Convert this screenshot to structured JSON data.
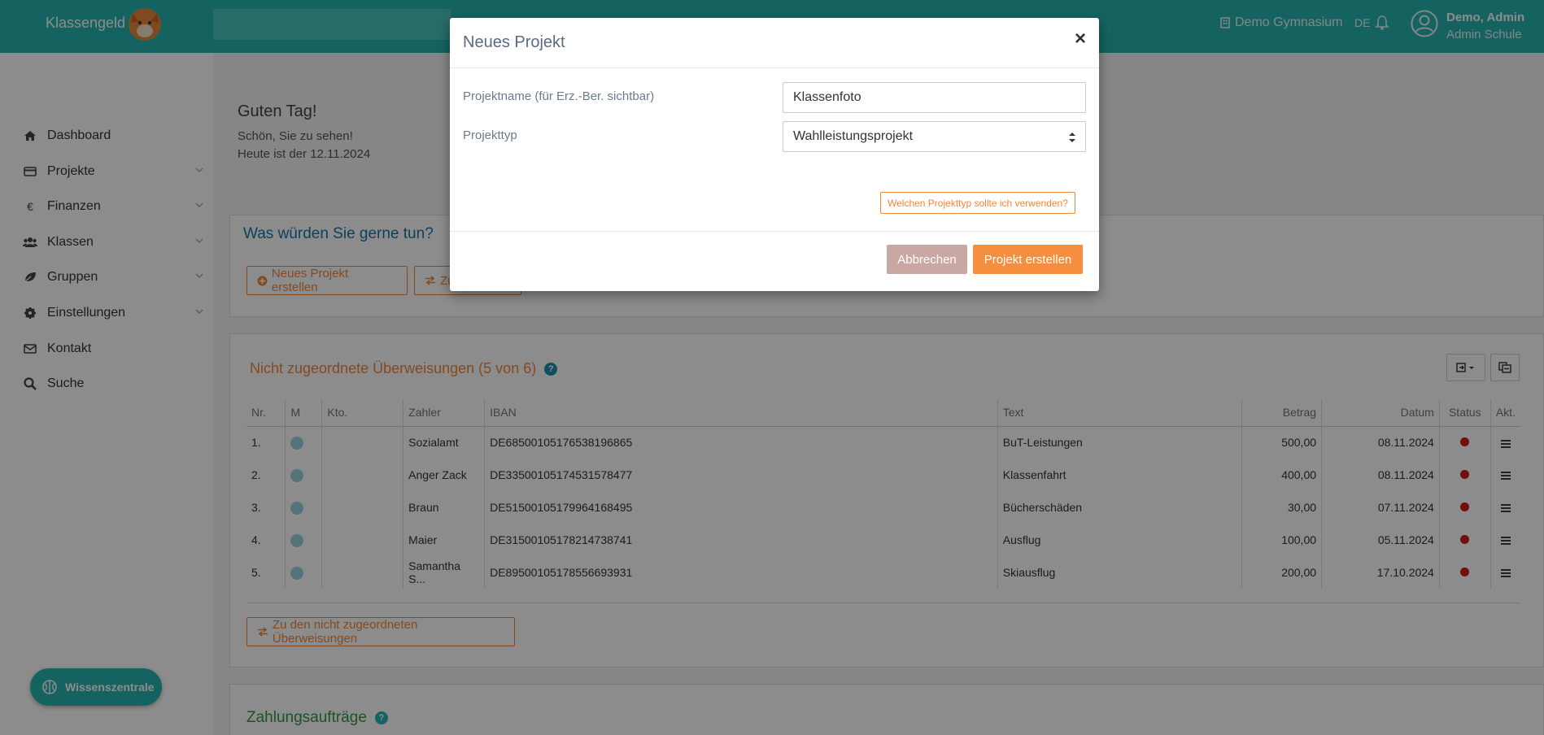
{
  "header": {
    "brand": "Klassengeld",
    "school": "Demo Gymnasium",
    "language": "DE",
    "user_name": "Demo, Admin",
    "user_role": "Admin Schule",
    "accent_color": "#27b5b0"
  },
  "sidebar": {
    "items": [
      {
        "label": "Dashboard",
        "icon": "home-icon"
      },
      {
        "label": "Projekte",
        "icon": "credit-card-icon"
      },
      {
        "label": "Finanzen",
        "icon": "euro-icon"
      },
      {
        "label": "Klassen",
        "icon": "users-icon"
      },
      {
        "label": "Gruppen",
        "icon": "leaf-icon"
      },
      {
        "label": "Einstellungen",
        "icon": "gear-icon"
      },
      {
        "label": "Kontakt",
        "icon": "envelope-icon"
      },
      {
        "label": "Suche",
        "icon": "search-icon"
      }
    ],
    "wissenszentrale": "Wissenszentrale"
  },
  "greeting": {
    "title": "Guten Tag!",
    "line1": "Schön, Sie zu sehen!",
    "line2": "Heute ist der 12.11.2024"
  },
  "actions_panel": {
    "title": "Was würden Sie gerne tun?",
    "new_project": "Neues Projekt erstellen",
    "second_button_partial": "Zu"
  },
  "transfers": {
    "title": "Nicht zugeordnete Überweisungen (5 von 6)",
    "columns": [
      "Nr.",
      "M",
      "Kto.",
      "Zahler",
      "IBAN",
      "Text",
      "Betrag",
      "Datum",
      "Status",
      "Akt."
    ],
    "rows": [
      {
        "nr": "1.",
        "zahler": "Sozialamt",
        "iban": "DE68500105176538196865",
        "text": "BuT-Leistungen",
        "betrag": "500,00",
        "datum": "08.11.2024"
      },
      {
        "nr": "2.",
        "zahler": "Anger Zack",
        "iban": "DE33500105174531578477",
        "text": "Klassenfahrt",
        "betrag": "400,00",
        "datum": "08.11.2024"
      },
      {
        "nr": "3.",
        "zahler": "Braun",
        "iban": "DE51500105179964168495",
        "text": "Bücherschäden",
        "betrag": "30,00",
        "datum": "07.11.2024"
      },
      {
        "nr": "4.",
        "zahler": "Maier",
        "iban": "DE31500105178214738741",
        "text": "Ausflug",
        "betrag": "100,00",
        "datum": "05.11.2024"
      },
      {
        "nr": "5.",
        "zahler": "Samantha S...",
        "iban": "DE89500105178556693931",
        "text": "Skiausflug",
        "betrag": "200,00",
        "datum": "17.10.2024"
      }
    ],
    "link_button": "Zu den nicht zugeordneten Überweisungen"
  },
  "zahlungsauftraege": {
    "title": "Zahlungsaufträge"
  },
  "modal": {
    "title": "Neues Projekt",
    "close": "×",
    "name_label": "Projektname (für Erz.-Ber. sichtbar)",
    "name_value": "Klassenfoto",
    "type_label": "Projekttyp",
    "type_value": "Wahlleistungsprojekt",
    "hint": "Welchen Projekttyp sollte ich verwenden?",
    "cancel": "Abbrechen",
    "create": "Projekt erstellen"
  }
}
